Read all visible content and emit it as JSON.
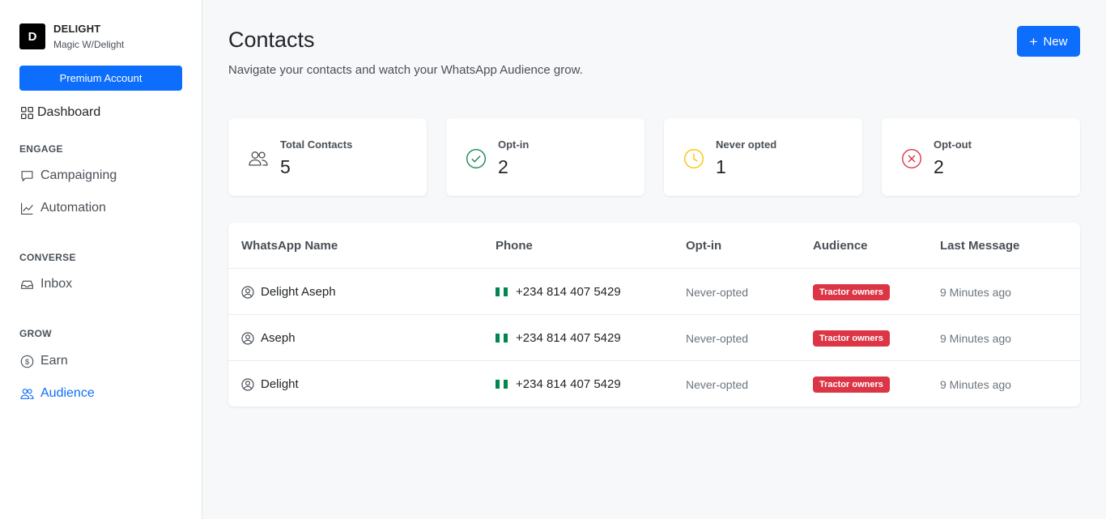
{
  "brand": {
    "logo_letter": "D",
    "name": "DELIGHT",
    "subtitle": "Magic W/Delight"
  },
  "sidebar": {
    "premium_label": "Premium Account",
    "dashboard_label": "Dashboard",
    "sections": [
      {
        "label": "ENGAGE",
        "items": [
          {
            "label": "Campaigning",
            "icon": "chat-icon"
          },
          {
            "label": "Automation",
            "icon": "chart-line-icon"
          }
        ]
      },
      {
        "label": "CONVERSE",
        "items": [
          {
            "label": "Inbox",
            "icon": "inbox-icon"
          }
        ]
      },
      {
        "label": "GROW",
        "items": [
          {
            "label": "Earn",
            "icon": "dollar-coin-icon"
          },
          {
            "label": "Audience",
            "icon": "people-icon",
            "active": true
          }
        ]
      }
    ]
  },
  "header": {
    "title": "Contacts",
    "subtitle": "Navigate your contacts and watch your WhatsApp Audience grow.",
    "new_button_icon": "+",
    "new_button_label": "New"
  },
  "stats": [
    {
      "label": "Total Contacts",
      "value": "5",
      "icon": "people-icon",
      "color": "#495057"
    },
    {
      "label": "Opt-in",
      "value": "2",
      "icon": "check-circle-icon",
      "color": "#198754"
    },
    {
      "label": "Never opted",
      "value": "1",
      "icon": "clock-icon",
      "color": "#ffc107"
    },
    {
      "label": "Opt-out",
      "value": "2",
      "icon": "x-circle-icon",
      "color": "#dc3545"
    }
  ],
  "table": {
    "columns": [
      "WhatsApp Name",
      "Phone",
      "Opt-in",
      "Audience",
      "Last Message"
    ],
    "rows": [
      {
        "name": "Delight Aseph",
        "phone": "+234 814 407 5429",
        "opt_in": "Never-opted",
        "audience": "Tractor owners",
        "last_message": "9 Minutes ago"
      },
      {
        "name": "Aseph",
        "phone": "+234 814 407 5429",
        "opt_in": "Never-opted",
        "audience": "Tractor owners",
        "last_message": "9 Minutes ago"
      },
      {
        "name": "Delight",
        "phone": "+234 814 407 5429",
        "opt_in": "Never-opted",
        "audience": "Tractor owners",
        "last_message": "9 Minutes ago"
      }
    ]
  },
  "colors": {
    "accent": "#0d6efd",
    "badge": "#dc3545",
    "flag_green": "#008751",
    "flag_white": "#ffffff"
  }
}
